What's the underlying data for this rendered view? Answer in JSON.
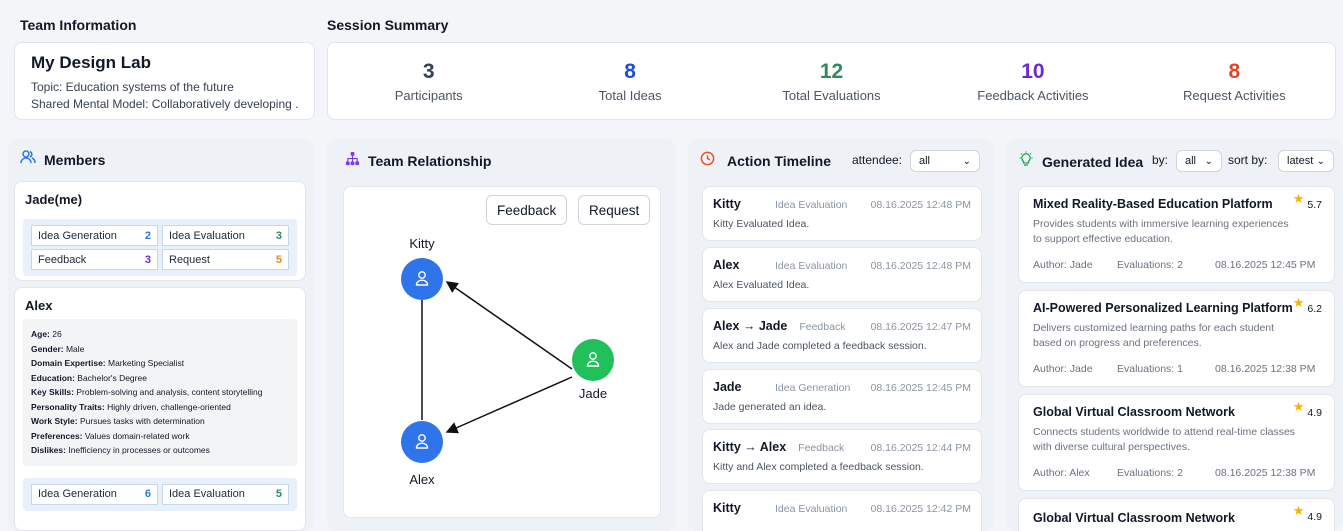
{
  "team_info": {
    "section_label": "Team Information",
    "name": "My Design Lab",
    "topic": "Topic: Education systems of the future",
    "shared_model": "Shared Mental Model: Collaboratively developing .."
  },
  "summary": {
    "section_label": "Session Summary",
    "stats": [
      {
        "value": "3",
        "label": "Participants",
        "color": "#334155"
      },
      {
        "value": "8",
        "label": "Total Ideas",
        "color": "#1d4ed8"
      },
      {
        "value": "12",
        "label": "Total Evaluations",
        "color": "#2f8a5e"
      },
      {
        "value": "10",
        "label": "Feedback Activities",
        "color": "#6d28d9"
      },
      {
        "value": "8",
        "label": "Request Activities",
        "color": "#dc4a25"
      }
    ]
  },
  "members": {
    "title": "Members",
    "metric_labels": {
      "idea_generation": "Idea Generation",
      "idea_evaluation": "Idea Evaluation",
      "feedback": "Feedback",
      "request": "Request"
    },
    "list": [
      {
        "name": "Jade(me)",
        "idea_generation": "2",
        "idea_evaluation": "3",
        "feedback": "3",
        "request": "5"
      },
      {
        "name": "Alex",
        "idea_generation": "6",
        "idea_evaluation": "5",
        "profile": [
          {
            "key": "Age:",
            "value": " 26"
          },
          {
            "key": "Gender:",
            "value": " Male"
          },
          {
            "key": "Domain Expertise:",
            "value": " Marketing Specialist"
          },
          {
            "key": "Education:",
            "value": " Bachelor's Degree"
          },
          {
            "key": "Key Skills:",
            "value": " Problem-solving and analysis, content storytelling"
          },
          {
            "key": "Personality Traits:",
            "value": " Highly driven, challenge-oriented"
          },
          {
            "key": "Work Style:",
            "value": " Pursues tasks with determination"
          },
          {
            "key": "Preferences:",
            "value": " Values domain-related work"
          },
          {
            "key": "Dislikes:",
            "value": " Inefficiency in processes or outcomes"
          }
        ]
      }
    ]
  },
  "relationship": {
    "title": "Team Relationship",
    "buttons": {
      "feedback": "Feedback",
      "request": "Request"
    },
    "nodes": {
      "kitty": "Kitty",
      "jade": "Jade",
      "alex": "Alex"
    },
    "colors": {
      "member": "#2f74ea",
      "self": "#22c05a"
    }
  },
  "timeline": {
    "title": "Action Timeline",
    "filter_label": "attendee:",
    "filter_value": "all",
    "items": [
      {
        "actor": "Kitty",
        "type": "Idea Evaluation",
        "time": "08.16.2025 12:48 PM",
        "desc": "Kitty Evaluated Idea."
      },
      {
        "actor": "Alex",
        "type": "Idea Evaluation",
        "time": "08.16.2025 12:48 PM",
        "desc": "Alex Evaluated Idea."
      },
      {
        "actor": "Alex → Jade",
        "type": "Feedback",
        "time": "08.16.2025 12:47 PM",
        "desc": "Alex and Jade completed a feedback session."
      },
      {
        "actor": "Jade",
        "type": "Idea Generation",
        "time": "08.16.2025 12:45 PM",
        "desc": "Jade generated an idea."
      },
      {
        "actor": "Kitty → Alex",
        "type": "Feedback",
        "time": "08.16.2025 12:44 PM",
        "desc": "Kitty and Alex completed a feedback session."
      },
      {
        "actor": "Kitty",
        "type": "Idea Evaluation",
        "time": "08.16.2025 12:42 PM",
        "desc": ""
      }
    ]
  },
  "ideas": {
    "title": "Generated Idea",
    "by_label": "by:",
    "by_value": "all",
    "sort_label": "sort by:",
    "sort_value": "latest",
    "items": [
      {
        "title": "Mixed Reality-Based Education Platform",
        "score": "5.7",
        "desc": "Provides students with immersive learning experiences to support effective education.",
        "author": "Author: Jade",
        "evaluations": "Evaluations: 2",
        "time": "08.16.2025 12:45 PM"
      },
      {
        "title": "AI-Powered Personalized Learning Platform",
        "score": "6.2",
        "desc": "Delivers customized learning paths for each student based on progress and preferences.",
        "author": "Author: Jade",
        "evaluations": "Evaluations: 1",
        "time": "08.16.2025 12:38 PM"
      },
      {
        "title": "Global Virtual Classroom Network",
        "score": "4.9",
        "desc": "Connects students worldwide to attend real-time classes with diverse cultural perspectives.",
        "author": "Author: Alex",
        "evaluations": "Evaluations: 2",
        "time": "08.16.2025 12:38 PM"
      },
      {
        "title": "Global Virtual Classroom Network",
        "score": "4.9",
        "desc": "",
        "author": "",
        "evaluations": "",
        "time": ""
      }
    ]
  }
}
